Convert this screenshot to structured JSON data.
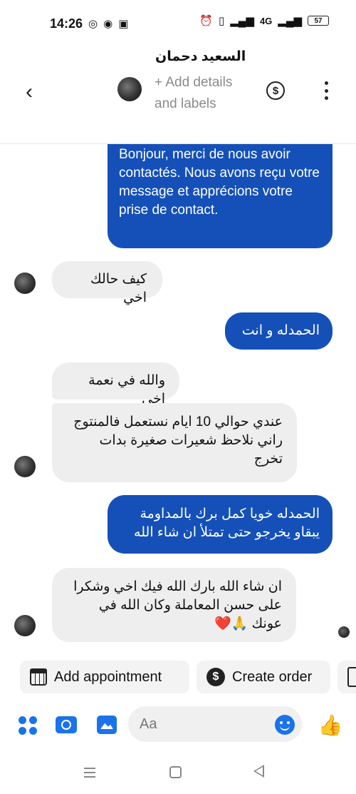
{
  "status_bar": {
    "time": "14:26",
    "left_icons": [
      "whatsapp-icon",
      "messenger-icon",
      "instagram-icon"
    ],
    "right_icons": [
      "alarm-icon",
      "vibrate-icon",
      "signal-icon",
      "4g-icon",
      "signal-icon"
    ],
    "network_label": "4G",
    "battery": "57"
  },
  "header": {
    "contact_name": "السعيد دحمان",
    "subtitle": "+ Add details and labels",
    "back_icon": "chevron-left-icon",
    "currency_icon": "dollar-icon",
    "more_icon": "more-vertical-icon"
  },
  "messages": [
    {
      "direction": "outgoing",
      "text": "Bonjour, merci de nous avoir contactés. Nous avons reçu votre message et apprécions votre prise de contact."
    },
    {
      "direction": "incoming",
      "text": "كيف حالك اخي"
    },
    {
      "direction": "outgoing",
      "text": "الحمدله و انت"
    },
    {
      "direction": "incoming",
      "text": "والله في نعمة اخي"
    },
    {
      "direction": "incoming",
      "text": "عندي حوالي 10 ايام نستعمل فالمنتوج راني نلاحظ شعيرات صغيرة بدات تخرج"
    },
    {
      "direction": "outgoing",
      "text": "الحمدله خويا كمل برك بالمداومة يبقاو يخرجو حتى تمتلأ ان شاء الله"
    },
    {
      "direction": "incoming",
      "text": "ان شاء الله بارك الله فيك اخي وشكرا على حسن المعاملة وكان الله في عونك 🙏❤️"
    }
  ],
  "quick_actions": [
    {
      "label": "Add appointment",
      "icon": "calendar-icon"
    },
    {
      "label": "Create order",
      "icon": "dollar-circle-icon"
    },
    {
      "label": "",
      "icon": "document-icon"
    }
  ],
  "composer": {
    "placeholder": "Aa",
    "icons": [
      "apps-icon",
      "camera-icon",
      "image-icon",
      "emoji-icon",
      "thumbs-up-icon"
    ]
  },
  "colors": {
    "outgoing_bubble": "#1450b8",
    "incoming_bubble": "#eeeeee",
    "accent": "#1a73e8"
  }
}
